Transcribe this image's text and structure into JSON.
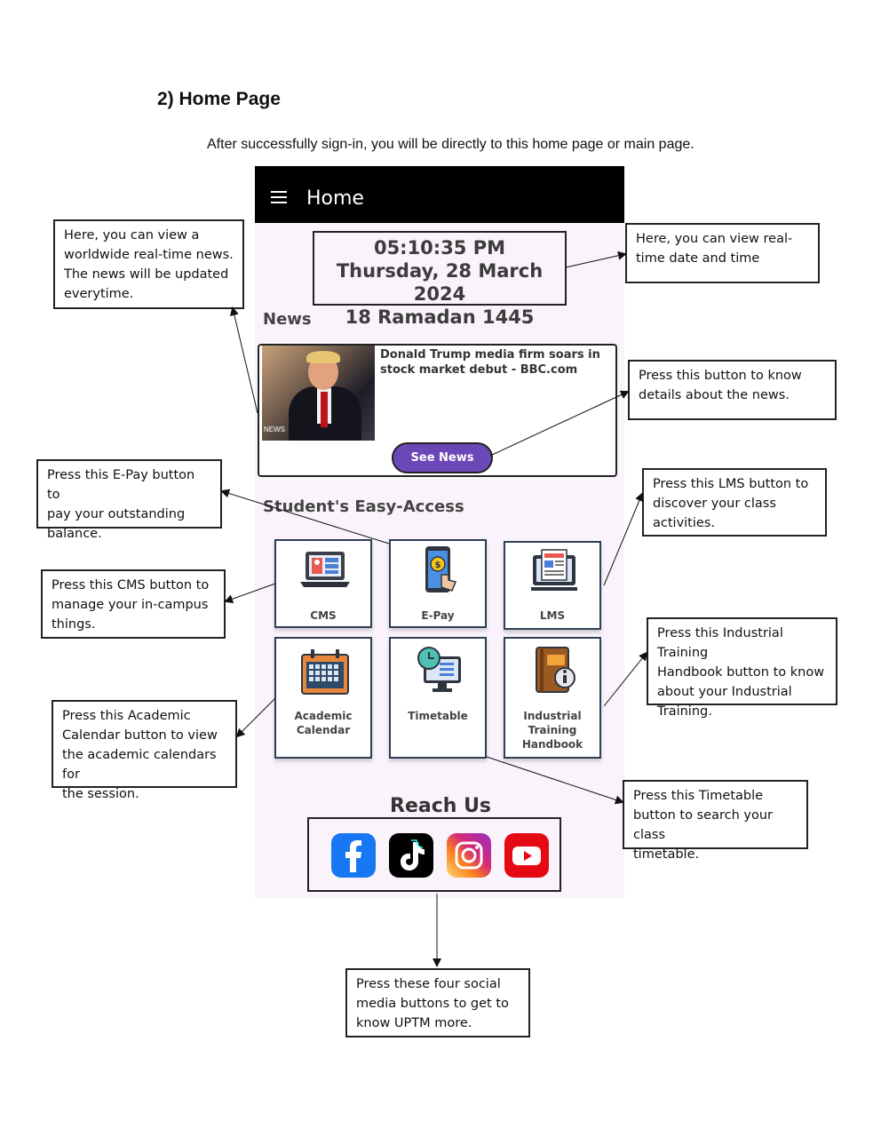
{
  "document": {
    "heading": "2) Home Page",
    "intro": "After successfully sign-in, you will be directly to this home page or main page."
  },
  "app": {
    "title": "Home",
    "clock": {
      "time": "05:10:35 PM",
      "date": "Thursday, 28 March 2024",
      "hijri": "18 Ramadan 1445"
    },
    "news": {
      "section_title": "News",
      "headline": "Donald Trump media firm soars in stock market debut - BBC.com",
      "image_tag": "NEWS",
      "button_label": "See News"
    },
    "easy_access": {
      "section_title": "Student's Easy-Access",
      "tiles": [
        {
          "label": "CMS",
          "icon": "laptop-icon"
        },
        {
          "label": "E-Pay",
          "icon": "phone-pay-icon"
        },
        {
          "label": "LMS",
          "icon": "monitor-news-icon"
        },
        {
          "label": "Academic Calendar",
          "icon": "calendar-icon"
        },
        {
          "label": "Timetable",
          "icon": "timetable-icon"
        },
        {
          "label": "Industrial Training Handbook",
          "icon": "handbook-icon"
        }
      ]
    },
    "reach_us": {
      "title": "Reach Us",
      "socials": [
        {
          "name": "facebook-icon",
          "color": "#1877f2"
        },
        {
          "name": "tiktok-icon",
          "color": "#010101"
        },
        {
          "name": "instagram-icon",
          "color": "#e1306c"
        },
        {
          "name": "youtube-icon",
          "color": "#ff0000"
        }
      ]
    }
  },
  "annotations": {
    "news": [
      "Here, you can view a",
      "worldwide real-time news.",
      "The news will be updated",
      "everytime."
    ],
    "datetime": [
      "Here, you can view real-",
      "time date and time"
    ],
    "see_news": [
      "Press this button to know",
      "details about the news."
    ],
    "epay": [
      "Press this E-Pay button to",
      "pay your outstanding",
      "balance."
    ],
    "lms": [
      "Press this LMS button to",
      "discover your class",
      "activities."
    ],
    "cms": [
      "Press this CMS button to",
      "manage your in-campus",
      "things."
    ],
    "industrial": [
      "Press this Industrial Training",
      "Handbook button to know",
      "about your Industrial",
      "Training."
    ],
    "academic": [
      "Press this Academic",
      "Calendar button to view",
      "the academic calendars for",
      "the session."
    ],
    "timetable": [
      "Press this Timetable",
      "button to search your class",
      "timetable."
    ],
    "social": [
      "Press these four social",
      "media buttons to get to",
      "know UPTM more."
    ]
  }
}
